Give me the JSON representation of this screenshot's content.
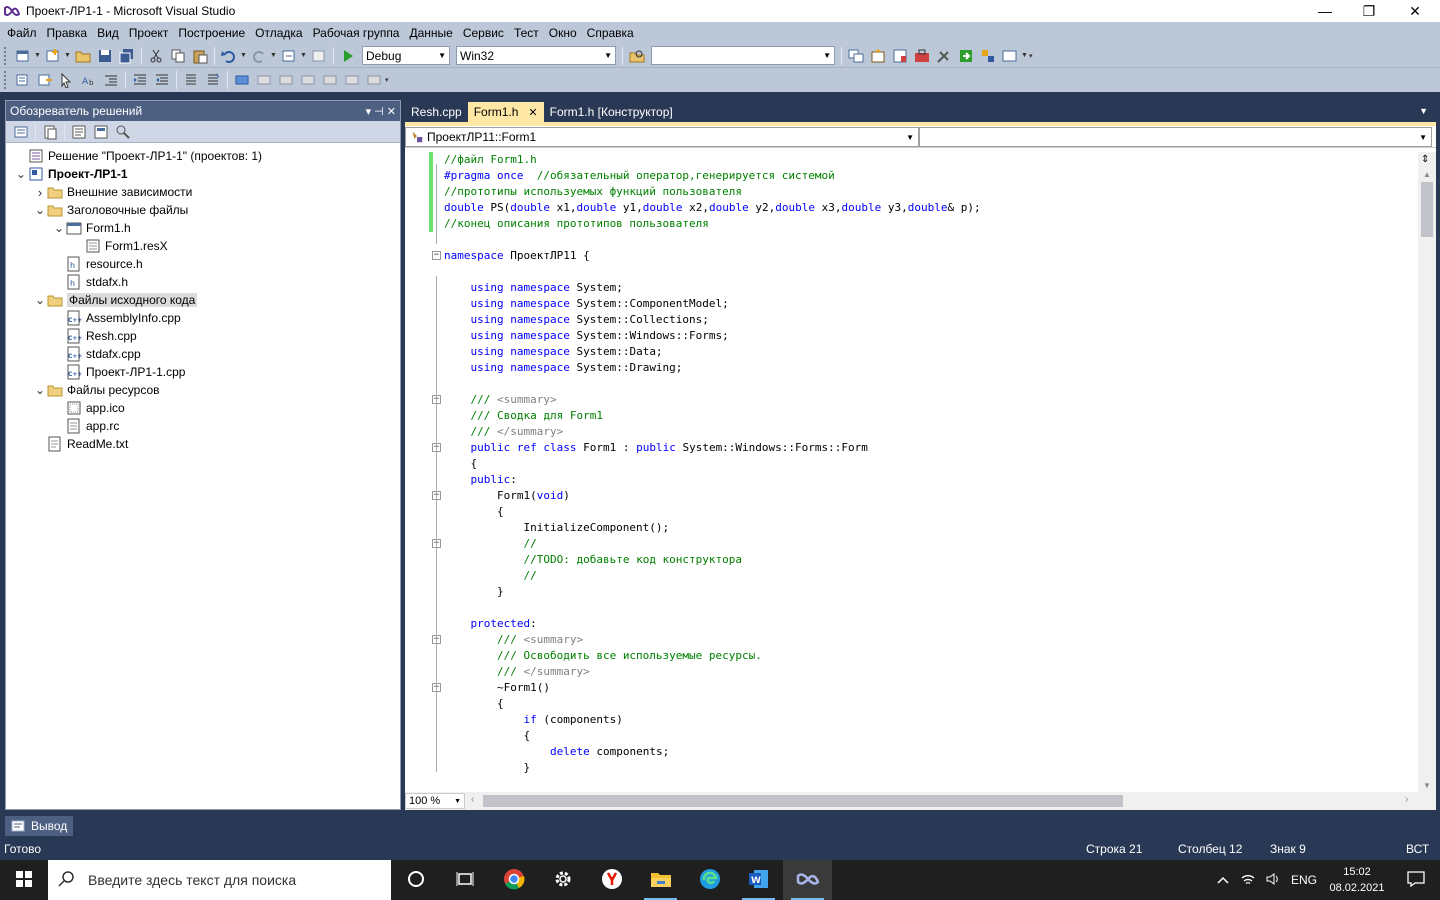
{
  "window": {
    "title": "Проект-ЛР1-1 - Microsoft Visual Studio",
    "min": "—",
    "max": "❐",
    "close": "✕"
  },
  "menu": [
    "Файл",
    "Правка",
    "Вид",
    "Проект",
    "Построение",
    "Отладка",
    "Рабочая группа",
    "Данные",
    "Сервис",
    "Тест",
    "Окно",
    "Справка"
  ],
  "toolbar": {
    "config": "Debug",
    "platform": "Win32",
    "find_value": ""
  },
  "solution_explorer": {
    "title": "Обозреватель решений",
    "pin": "▾  ⊣  ✕",
    "items": [
      {
        "label": "Решение \"Проект-ЛР1-1\"  (проектов: 1)",
        "icon": "solution-icon",
        "indent": 0,
        "arrow": ""
      },
      {
        "label": "Проект-ЛР1-1",
        "icon": "project-icon",
        "indent": 0,
        "arrow": "expanded",
        "bold": true
      },
      {
        "label": "Внешние зависимости",
        "icon": "folder-icon",
        "indent": 1,
        "arrow": "collapsed"
      },
      {
        "label": "Заголовочные файлы",
        "icon": "folder-icon",
        "indent": 1,
        "arrow": "expanded"
      },
      {
        "label": "Form1.h",
        "icon": "form-icon",
        "indent": 2,
        "arrow": "expanded"
      },
      {
        "label": "Form1.resX",
        "icon": "resx-icon",
        "indent": 3,
        "arrow": ""
      },
      {
        "label": "resource.h",
        "icon": "h-file-icon",
        "indent": 2,
        "arrow": ""
      },
      {
        "label": "stdafx.h",
        "icon": "h-file-icon",
        "indent": 2,
        "arrow": ""
      },
      {
        "label": "Файлы исходного кода",
        "icon": "folder-icon",
        "indent": 1,
        "arrow": "expanded",
        "selected": true
      },
      {
        "label": "AssemblyInfo.cpp",
        "icon": "cpp-file-icon",
        "indent": 2,
        "arrow": ""
      },
      {
        "label": "Resh.cpp",
        "icon": "cpp-file-icon",
        "indent": 2,
        "arrow": ""
      },
      {
        "label": "stdafx.cpp",
        "icon": "cpp-file-icon",
        "indent": 2,
        "arrow": ""
      },
      {
        "label": "Проект-ЛР1-1.cpp",
        "icon": "cpp-file-icon",
        "indent": 2,
        "arrow": ""
      },
      {
        "label": "Файлы ресурсов",
        "icon": "folder-icon",
        "indent": 1,
        "arrow": "expanded"
      },
      {
        "label": "app.ico",
        "icon": "ico-file-icon",
        "indent": 2,
        "arrow": ""
      },
      {
        "label": "app.rc",
        "icon": "rc-file-icon",
        "indent": 2,
        "arrow": ""
      },
      {
        "label": "ReadMe.txt",
        "icon": "txt-file-icon",
        "indent": 1,
        "arrow": ""
      }
    ]
  },
  "tabs": [
    {
      "label": "Resh.cpp",
      "active": false
    },
    {
      "label": "Form1.h",
      "active": true
    },
    {
      "label": "Form1.h [Конструктор]",
      "active": false
    }
  ],
  "editor": {
    "scope": "ПроектЛР11::Form1",
    "member": "",
    "zoom": "100 %",
    "lines": [
      [
        [
          "cm",
          "//файл Form1.h"
        ]
      ],
      [
        [
          "kw",
          "#pragma once"
        ],
        [
          "",
          "  "
        ],
        [
          "cm",
          "//обязательный оператор,генерируется системой"
        ]
      ],
      [
        [
          "cm",
          "//прототипы используемых функций пользователя"
        ]
      ],
      [
        [
          "kw",
          "double"
        ],
        [
          "",
          " PS("
        ],
        [
          "kw",
          "double"
        ],
        [
          "",
          " x1,"
        ],
        [
          "kw",
          "double"
        ],
        [
          "",
          " y1,"
        ],
        [
          "kw",
          "double"
        ],
        [
          "",
          " x2,"
        ],
        [
          "kw",
          "double"
        ],
        [
          "",
          " y2,"
        ],
        [
          "kw",
          "double"
        ],
        [
          "",
          " x3,"
        ],
        [
          "kw",
          "double"
        ],
        [
          "",
          " y3,"
        ],
        [
          "kw",
          "double"
        ],
        [
          "",
          "& p);"
        ]
      ],
      [
        [
          "cm",
          "//конец описания прототипов пользователя"
        ]
      ],
      [],
      [
        [
          "kw",
          "namespace"
        ],
        [
          "",
          " ПроектЛР11 {"
        ]
      ],
      [],
      [
        [
          "",
          "    "
        ],
        [
          "kw",
          "using namespace"
        ],
        [
          "",
          " System;"
        ]
      ],
      [
        [
          "",
          "    "
        ],
        [
          "kw",
          "using namespace"
        ],
        [
          "",
          " System::ComponentModel;"
        ]
      ],
      [
        [
          "",
          "    "
        ],
        [
          "kw",
          "using namespace"
        ],
        [
          "",
          " System::Collections;"
        ]
      ],
      [
        [
          "",
          "    "
        ],
        [
          "kw",
          "using namespace"
        ],
        [
          "",
          " System::Windows::Forms;"
        ]
      ],
      [
        [
          "",
          "    "
        ],
        [
          "kw",
          "using namespace"
        ],
        [
          "",
          " System::Data;"
        ]
      ],
      [
        [
          "",
          "    "
        ],
        [
          "kw",
          "using namespace"
        ],
        [
          "",
          " System::Drawing;"
        ]
      ],
      [],
      [
        [
          "",
          "    "
        ],
        [
          "cm",
          "/// "
        ],
        [
          "xd",
          "<summary>"
        ]
      ],
      [
        [
          "",
          "    "
        ],
        [
          "cm",
          "/// Сводка для Form1"
        ]
      ],
      [
        [
          "",
          "    "
        ],
        [
          "cm",
          "/// "
        ],
        [
          "xd",
          "</summary>"
        ]
      ],
      [
        [
          "",
          "    "
        ],
        [
          "kw",
          "public ref class"
        ],
        [
          "",
          " Form1 : "
        ],
        [
          "kw",
          "public"
        ],
        [
          "",
          " System::Windows::Forms::Form"
        ]
      ],
      [
        [
          "",
          "    {"
        ]
      ],
      [
        [
          "",
          "    "
        ],
        [
          "kw",
          "public"
        ],
        [
          "",
          ":"
        ]
      ],
      [
        [
          "",
          "        Form1("
        ],
        [
          "kw",
          "void"
        ],
        [
          "",
          ")"
        ]
      ],
      [
        [
          "",
          "        {"
        ]
      ],
      [
        [
          "",
          "            InitializeComponent();"
        ]
      ],
      [
        [
          "",
          "            "
        ],
        [
          "cm",
          "//"
        ]
      ],
      [
        [
          "",
          "            "
        ],
        [
          "cm",
          "//TODO: добавьте код конструктора"
        ]
      ],
      [
        [
          "",
          "            "
        ],
        [
          "cm",
          "//"
        ]
      ],
      [
        [
          "",
          "        }"
        ]
      ],
      [],
      [
        [
          "",
          "    "
        ],
        [
          "kw",
          "protected"
        ],
        [
          "",
          ":"
        ]
      ],
      [
        [
          "",
          "        "
        ],
        [
          "cm",
          "/// "
        ],
        [
          "xd",
          "<summary>"
        ]
      ],
      [
        [
          "",
          "        "
        ],
        [
          "cm",
          "/// Освободить все используемые ресурсы."
        ]
      ],
      [
        [
          "",
          "        "
        ],
        [
          "cm",
          "/// "
        ],
        [
          "xd",
          "</summary>"
        ]
      ],
      [
        [
          "",
          "        ~Form1()"
        ]
      ],
      [
        [
          "",
          "        {"
        ]
      ],
      [
        [
          "",
          "            "
        ],
        [
          "kw",
          "if"
        ],
        [
          "",
          " (components)"
        ]
      ],
      [
        [
          "",
          "            {"
        ]
      ],
      [
        [
          "",
          "                "
        ],
        [
          "kw",
          "delete"
        ],
        [
          "",
          " components;"
        ]
      ],
      [
        [
          "",
          "            }"
        ]
      ]
    ]
  },
  "output_tab": "Вывод",
  "status": {
    "ready": "Готово",
    "line": "Строка 21",
    "col": "Столбец 12",
    "char": "Знак 9",
    "mode": "ВСТ"
  },
  "taskbar": {
    "search_placeholder": "Введите здесь текст для поиска",
    "lang": "ENG",
    "time": "15:02",
    "date": "08.02.2021"
  }
}
